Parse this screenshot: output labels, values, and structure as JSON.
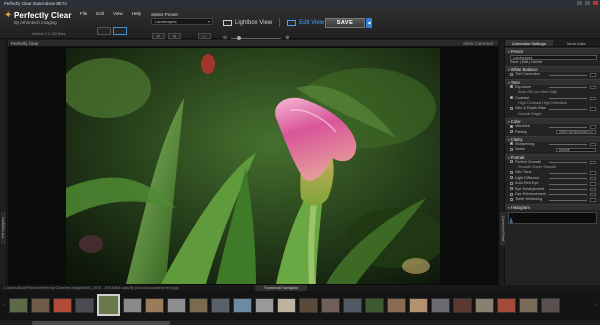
{
  "window": {
    "title": "Perfectly Clear Stand-alone BETA"
  },
  "branding": {
    "logo_icon": "star-icon",
    "name": "Perfectly Clear",
    "byline": "By Athentech Imaging",
    "version": "Version 0.0.150 Beta"
  },
  "menu": [
    "File",
    "Edit",
    "View",
    "Help"
  ],
  "preset": {
    "label": "Select Preset",
    "value": "Landscapes"
  },
  "view_tabs": {
    "lightbox": "Lightbox View",
    "edit": "Edit View"
  },
  "save": {
    "label": "SAVE"
  },
  "viewer": {
    "header_title": "Perfectly Clear",
    "header_right": "Show Corrected",
    "left_tab": "File Navigator",
    "right_tab": "Correction Panel"
  },
  "panel": {
    "tabs": [
      "Correction Settings",
      "Meta Data"
    ],
    "preset_section": "Preset",
    "preset_value": "Landscapes",
    "preset_actions": "Save | Edit | Delete",
    "sections": [
      {
        "title": "White Balance",
        "rows": [
          {
            "label": "Tint Correction",
            "checked": false
          }
        ]
      },
      {
        "title": "Tone",
        "rows": [
          {
            "label": "Exposure",
            "checked": true
          },
          {
            "label": "Auto   Off   Low   Med   High",
            "sub": true
          },
          {
            "label": "Contrast",
            "checked": true
          },
          {
            "label": "High Contrast   High Definition",
            "sub": true
          },
          {
            "label": "Skin & Depth Bias",
            "checked": false
          },
          {
            "label": "Normal   Bright",
            "sub": true
          }
        ]
      },
      {
        "title": "Color",
        "rows": [
          {
            "label": "Vibrance",
            "checked": true
          },
          {
            "label": "Fidelity",
            "checked": false,
            "dropdown": "Vivid Full Spectrum Cu"
          }
        ]
      },
      {
        "title": "Clarity",
        "rows": [
          {
            "label": "Sharpening",
            "checked": true
          },
          {
            "label": "Noise",
            "checked": false,
            "dropdown": "Default"
          }
        ]
      },
      {
        "title": "Portrait",
        "rows": [
          {
            "label": "Perfect Smooth",
            "checked": false
          },
          {
            "label": "Smooth   Super Smooth",
            "sub": true
          },
          {
            "label": "Skin Tone",
            "checked": false
          },
          {
            "label": "Light Diffusion",
            "checked": false
          },
          {
            "label": "Auto Red Eye",
            "checked": false
          },
          {
            "label": "Eye Enlargement",
            "checked": false
          },
          {
            "label": "Eye Enhancement",
            "checked": false
          },
          {
            "label": "Teeth Whitening",
            "checked": false
          }
        ]
      }
    ],
    "histogram_title": "Histogram"
  },
  "footer": {
    "path": "C:\\Users\\Brad\\Pictures\\Perfectly Clear\\test images\\IMG_3976 - 20100504 calla lily (un-touch-undercorrect).jpg",
    "thumbnail_label": "Thumbnail Navigator"
  },
  "thumbnails": [
    {
      "color": "#5d6a4a"
    },
    {
      "color": "#6e5a48"
    },
    {
      "color": "#b24b3a"
    },
    {
      "color": "#4a4a52"
    },
    {
      "color": "#6a7a4c",
      "selected": true
    },
    {
      "color": "#8a8a8a"
    },
    {
      "color": "#9a7b5a"
    },
    {
      "color": "#8e8e90"
    },
    {
      "color": "#7a6a4e"
    },
    {
      "color": "#58606a"
    },
    {
      "color": "#6c8aa0"
    },
    {
      "color": "#9a9a9c"
    },
    {
      "color": "#bdb3a0"
    },
    {
      "color": "#5a4a3a"
    },
    {
      "color": "#6e6058"
    },
    {
      "color": "#505a62"
    },
    {
      "color": "#3e5a32"
    },
    {
      "color": "#8a6a50"
    },
    {
      "color": "#b39070"
    },
    {
      "color": "#6a6a70"
    },
    {
      "color": "#5a3a30"
    },
    {
      "color": "#8a8070"
    },
    {
      "color": "#a44a3a"
    },
    {
      "color": "#7a6a5a"
    },
    {
      "color": "#5a5050"
    }
  ],
  "colors": {
    "accent": "#3fa3ff",
    "logo": "#e8a23b"
  }
}
